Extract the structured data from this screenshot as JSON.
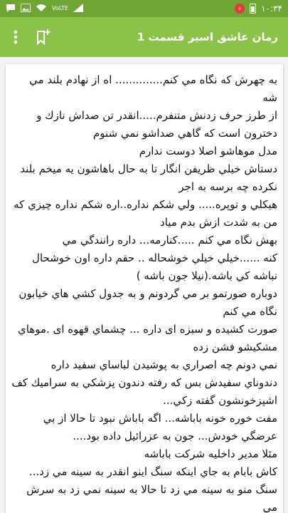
{
  "status_bar": {
    "time": "۱۰:۳۴",
    "network_label": "VoLTE",
    "colors": {
      "background": "#6ea533",
      "record_indicator": "#e53935"
    },
    "icons": [
      "battery-icon",
      "record-icon",
      "signal-icon",
      "network-icon",
      "wifi-icon",
      "image-icon",
      "chat-icon"
    ]
  },
  "app_bar": {
    "title": "رمان عاشق اسير قسمت 1",
    "background": "#8bc34a"
  },
  "content": {
    "lines": [
      "به چهرش كه نگاه مي كنم.............. اه از نهادم بلند مي شه",
      "از طرز حرف زدنش متنفرم.....انقدر تن صداش نازك و دخترون است كه گاهي صداشو نمي شنوم",
      "مدل موهاشو اصلا دوست ندارم",
      "دستاش خيلي ظريفن انگار تا به حال باهاشون يه ميخم بلند نكرده چه برسه به اجر",
      "هيكلي و توپره..... ولي شكم نداره..اره شكم نداره چيزي كه من به شدت ازش بدم مياد",
      "بهش نگاه مي كنم .....كنارمه... داره رانندگي مي",
      "كنه ......خيلي خيلي خوشحاله .. حقم داره اون خوشحال نباشه كي باشه.(نيلا جون باشه )",
      "دوباره صورتمو بر مي گردونم و به جدول كشي هاي خيابون نگاه مي كنم",
      "صورت كشيده و سبزه اى داره ... چشماي قهوه اى .موهاي مشكيشو فشن زده",
      "نمي دونم چه اصراري به پوشيدن لباساي سفيد داره",
      "دندوناي سفيدش بس كه رفته دندون پزشكي به سراميك كف اشپزخونشون گفته زكي...",
      "مفت خوره خونه باباشه... اگه باباش نبود تا حالا از بي عرضگي خودش... جون به عزرائيل داده بود....",
      "مثلا مدير داخليه شركت باباشه",
      "كاش بابام به جاي اينكه سنگ اينو انقدر به سينه مي زد...",
      "سنگ منو به سينه مي زد تا حالا به سينه نمي زد به سرش مي"
    ]
  }
}
